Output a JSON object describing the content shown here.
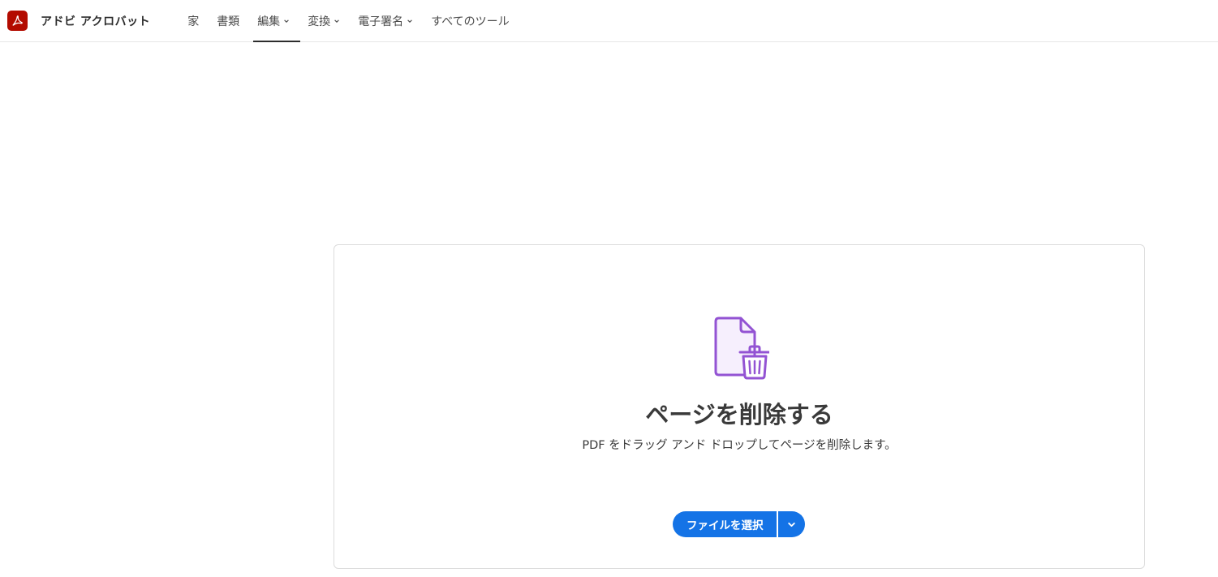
{
  "app": {
    "name": "アドビ アクロバット",
    "logo_icon": "acrobat-logo-icon",
    "brand_color": "#b30b00"
  },
  "nav": {
    "items": [
      {
        "label": "家",
        "has_dropdown": false,
        "active": false
      },
      {
        "label": "書類",
        "has_dropdown": false,
        "active": false
      },
      {
        "label": "編集",
        "has_dropdown": true,
        "active": true
      },
      {
        "label": "変換",
        "has_dropdown": true,
        "active": false
      },
      {
        "label": "電子署名",
        "has_dropdown": true,
        "active": false
      },
      {
        "label": "すべてのツール",
        "has_dropdown": false,
        "active": false
      }
    ]
  },
  "tool": {
    "icon": "delete-pages-icon",
    "icon_color": "#9353d3",
    "title": "ページを削除する",
    "description": "PDF をドラッグ アンド ドロップしてページを削除します。",
    "select_button_label": "ファイルを選択",
    "accent_color": "#1473e6"
  }
}
